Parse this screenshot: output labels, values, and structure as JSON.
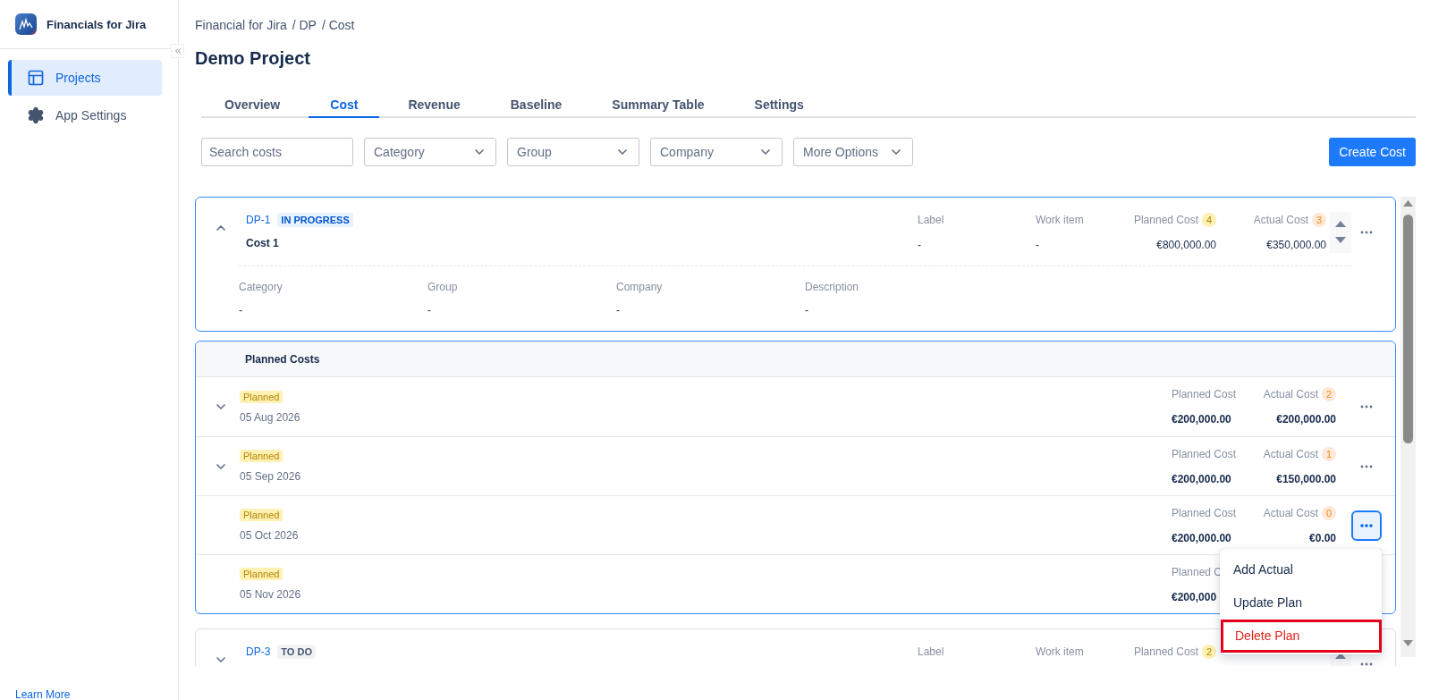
{
  "app": {
    "name": "Financials for Jira"
  },
  "sidebar": {
    "items": [
      {
        "label": "Projects",
        "selected": true
      },
      {
        "label": "App Settings",
        "selected": false
      }
    ],
    "footer_link": "Learn More"
  },
  "breadcrumb": [
    "Financial for Jira",
    "/ DP",
    "/ Cost"
  ],
  "title": "Demo Project",
  "tabs": [
    {
      "label": "Overview",
      "selected": false
    },
    {
      "label": "Cost",
      "selected": true
    },
    {
      "label": "Revenue",
      "selected": false
    },
    {
      "label": "Baseline",
      "selected": false
    },
    {
      "label": "Summary Table",
      "selected": false
    },
    {
      "label": "Settings",
      "selected": false
    }
  ],
  "filters": {
    "search": {
      "placeholder": "Search costs"
    },
    "dropdowns": [
      "Category",
      "Group",
      "Company",
      "More Options"
    ]
  },
  "create_button": "Create Cost",
  "items": [
    {
      "kind": "cost",
      "key": "DP-1",
      "status": {
        "label": "IN PROGRESS",
        "kind": "in_progress"
      },
      "name": "Cost 1",
      "expanded": true,
      "label_col": {
        "label": "Label",
        "value": "-"
      },
      "work_item_col": {
        "label": "Work item",
        "value": "-"
      },
      "planned_col": {
        "label": "Planned Cost",
        "count": "4",
        "value": "€800,000.00"
      },
      "actual_col": {
        "label": "Actual Cost",
        "count": "3",
        "value": "€350,000.00"
      },
      "details": [
        {
          "label": "Category",
          "value": "-"
        },
        {
          "label": "Group",
          "value": "-"
        },
        {
          "label": "Company",
          "value": "-"
        },
        {
          "label": "Description",
          "value": "-"
        }
      ]
    },
    {
      "kind": "planned_costs",
      "title": "Planned Costs",
      "rows": [
        {
          "tag": "Planned",
          "date": "05 Aug 2026",
          "expandable": true,
          "menu_open": false,
          "planned_label": "Planned Cost",
          "planned_value": "€200,000.00",
          "actual_label": "Actual Cost",
          "actual_count": "2",
          "actual_value": "€200,000.00"
        },
        {
          "tag": "Planned",
          "date": "05 Sep 2026",
          "expandable": true,
          "menu_open": false,
          "planned_label": "Planned Cost",
          "planned_value": "€200,000.00",
          "actual_label": "Actual Cost",
          "actual_count": "1",
          "actual_value": "€150,000.00"
        },
        {
          "tag": "Planned",
          "date": "05 Oct 2026",
          "expandable": false,
          "menu_open": true,
          "planned_label": "Planned Cost",
          "planned_value": "€200,000.00",
          "actual_label": "Actual Cost",
          "actual_count": "0",
          "actual_value": "€0.00"
        },
        {
          "tag": "Planned",
          "date": "05 Nov 2026",
          "expandable": false,
          "menu_open": false,
          "planned_label": "Planned C",
          "planned_value": "€200,000"
        }
      ]
    },
    {
      "kind": "cost",
      "key": "DP-3",
      "status": {
        "label": "TO DO",
        "kind": "todo"
      },
      "expanded": false,
      "label_col": {
        "label": "Label"
      },
      "work_item_col": {
        "label": "Work item"
      },
      "planned_col": {
        "label": "Planned Cost",
        "count": "2"
      }
    }
  ],
  "menu": {
    "items": [
      {
        "label": "Add Actual",
        "kind": "normal",
        "highlighted": false
      },
      {
        "label": "Update Plan",
        "kind": "normal",
        "highlighted": false
      },
      {
        "label": "Delete Plan",
        "kind": "danger",
        "highlighted": true
      }
    ]
  }
}
